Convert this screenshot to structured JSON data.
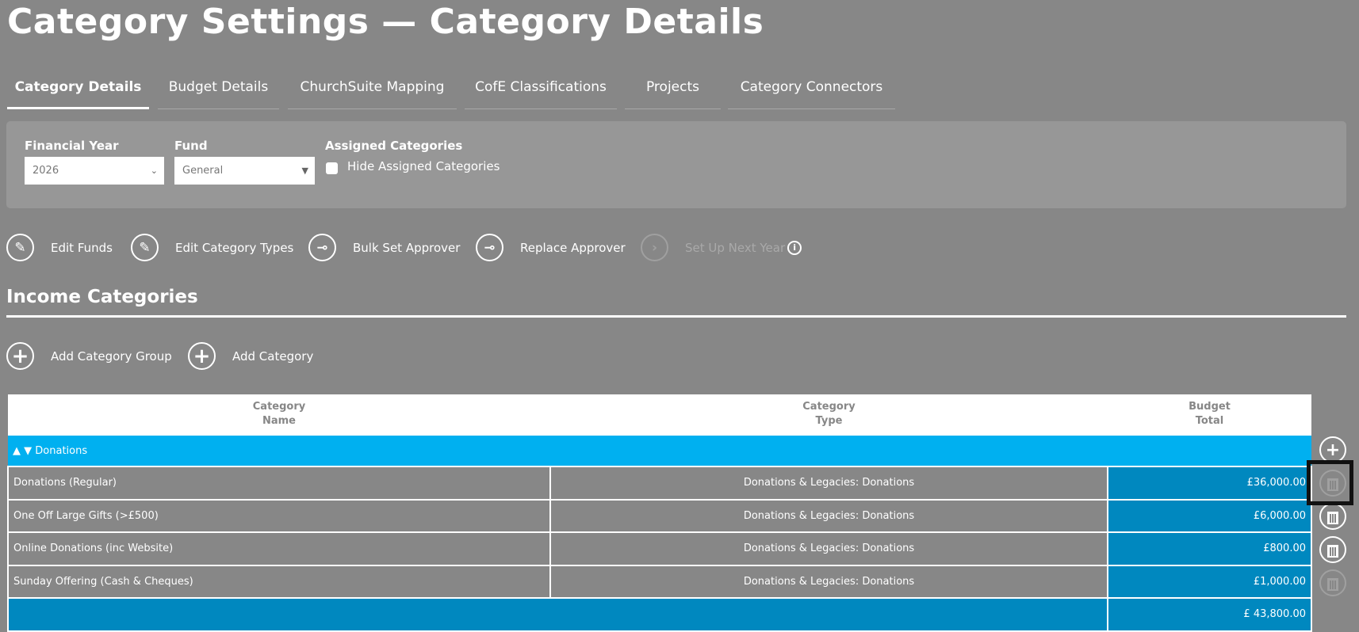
{
  "title": "Category Settings — Category Details",
  "tabs": [
    "Category Details",
    "Budget Details",
    "ChurchSuite Mapping",
    "CofE Classifications",
    "Projects",
    "Category Connectors"
  ],
  "filters": {
    "financial_year_label": "Financial Year",
    "financial_year_value": "2026",
    "fund_label": "Fund",
    "fund_value": "General",
    "assigned_label": "Assigned Categories",
    "hide_assigned_label": "Hide Assigned Categories"
  },
  "actions": {
    "edit_funds": "Edit Funds",
    "edit_types": "Edit Category Types",
    "bulk_set": "Bulk Set Approver",
    "replace": "Replace Approver",
    "next_year": "Set Up Next Year"
  },
  "income": {
    "heading": "Income Categories",
    "add_group": "Add Category Group",
    "add_category": "Add Category"
  },
  "table": {
    "headers": {
      "name1": "Category",
      "name2": "Name",
      "type1": "Category",
      "type2": "Type",
      "budget1": "Budget",
      "budget2": "Total"
    },
    "group": {
      "arrows": "▲ ▼",
      "name": "Donations"
    },
    "rows": [
      {
        "name": "Donations (Regular)",
        "type": "Donations & Legacies: Donations",
        "budget": "£36,000.00"
      },
      {
        "name": "One Off Large Gifts (>£500)",
        "type": "Donations & Legacies: Donations",
        "budget": "£6,000.00"
      },
      {
        "name": "Online Donations (inc Website)",
        "type": "Donations & Legacies: Donations",
        "budget": "£800.00"
      },
      {
        "name": "Sunday Offering (Cash & Cheques)",
        "type": "Donations & Legacies: Donations",
        "budget": "£1,000.00"
      }
    ],
    "total": "£ 43,800.00"
  },
  "colors": {
    "background": "#878787",
    "group": "#00b0f0",
    "budget": "#0088bf"
  }
}
